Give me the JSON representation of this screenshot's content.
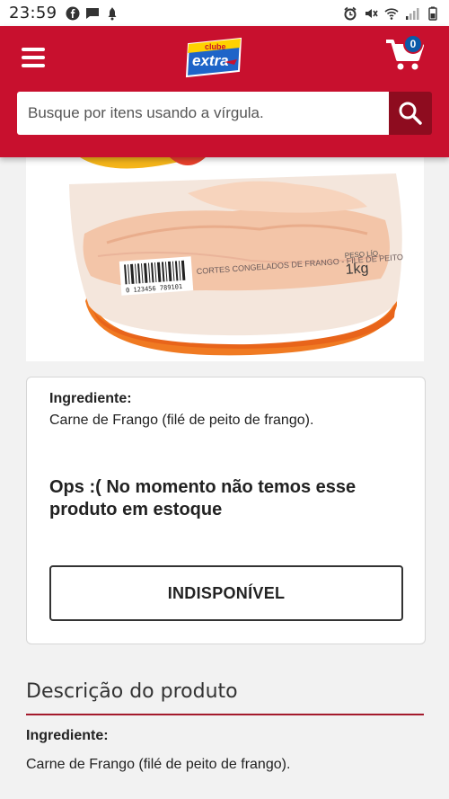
{
  "status_bar": {
    "time": "23:59",
    "left_icons": [
      "facebook-icon",
      "chat-icon",
      "notification-icon"
    ],
    "right_icons": [
      "alarm-icon",
      "mute-icon",
      "wifi-icon",
      "signal-icon",
      "battery-icon"
    ]
  },
  "header": {
    "brand_top": "clube",
    "brand_main": "extra",
    "cart_count": "0",
    "colors": {
      "primary": "#c8102e",
      "search_button": "#8e0c1f",
      "badge": "#0a5aa8"
    }
  },
  "search": {
    "placeholder": "Busque por itens usando a vírgula.",
    "value": ""
  },
  "product_image": {
    "package_text": "CORTES CONGELADOS DE FRANGO - FILÉ DE PEITO",
    "weight_label": "PESO LÍQ.",
    "weight": "1kg",
    "barcode_digits": "0 123456 789101"
  },
  "product_info": {
    "ingredient_label": "Ingrediente:",
    "ingredient_text": "Carne de Frango (filé de peito de frango).",
    "out_of_stock_message": "Ops :( No momento não temos esse produto em estoque",
    "unavailable_button": "INDISPONÍVEL"
  },
  "description": {
    "title": "Descrição do produto",
    "ingredient_label": "Ingrediente:",
    "ingredient_text": "Carne de Frango (filé de peito de frango)."
  }
}
